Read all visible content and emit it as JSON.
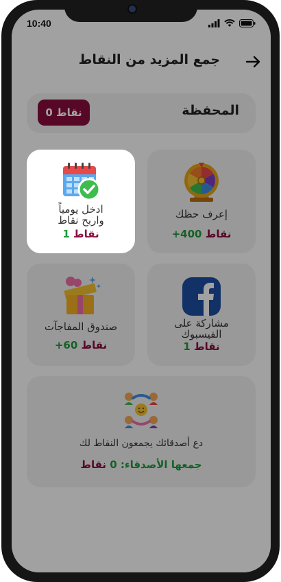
{
  "status_bar": {
    "time": "10:40"
  },
  "header": {
    "title": "جمع المزيد من النقاط"
  },
  "wallet": {
    "label": "المحفظة",
    "points": "0 نقاط"
  },
  "cards": {
    "daily": {
      "title_line1": "ادخل يومياً",
      "title_line2": "واربح  نقاط",
      "points_value": "1",
      "points_unit": "نقاط"
    },
    "wheel": {
      "title": "إعرف حظك",
      "points_value": "+400",
      "points_unit": "نقاط"
    },
    "gift": {
      "title": "صندوق المفاجآت",
      "points_value": "+60",
      "points_unit": "نقاط"
    },
    "facebook": {
      "title_line1": "مشاركة على",
      "title_line2": "الفيسبوك",
      "points_value": "1",
      "points_unit": "نقاط"
    }
  },
  "invite": {
    "text": "دع أصدقائك يجمعون النقاط لك",
    "collected_label": "جمعها الأصدقاء:",
    "collected_value": "0",
    "collected_unit": "نقاط"
  },
  "colors": {
    "maroon": "#8a0d3e",
    "green": "#1f9a3c",
    "card_bg": "#f2f2f2",
    "facebook_blue": "#1e4fa3"
  },
  "icons": [
    "back-arrow-icon",
    "calendar-check-icon",
    "fortune-wheel-icon",
    "gift-box-icon",
    "facebook-icon",
    "friends-group-icon",
    "signal-icon",
    "wifi-icon",
    "battery-icon"
  ]
}
